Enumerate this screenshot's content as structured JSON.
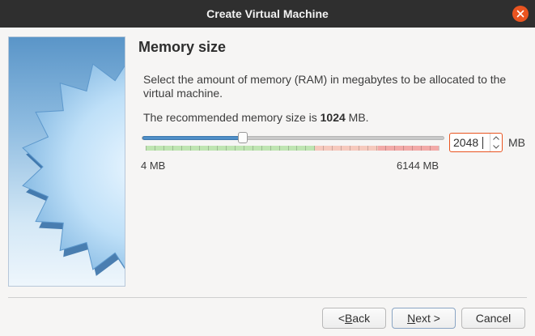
{
  "window": {
    "title": "Create Virtual Machine",
    "close_icon": "close-icon"
  },
  "page": {
    "title": "Memory size",
    "description": "Select the amount of memory (RAM) in megabytes to be allocated to the virtual machine.",
    "recommend_prefix": "The recommended memory size is ",
    "recommend_value": "1024",
    "recommend_suffix": " MB."
  },
  "memory": {
    "min_label": "4 MB",
    "max_label": "6144 MB",
    "value": "2048",
    "unit": "MB",
    "slider_fraction": 0.333
  },
  "buttons": {
    "back": {
      "pre": "< ",
      "mnemonic": "B",
      "post": "ack"
    },
    "next": {
      "pre": "",
      "mnemonic": "N",
      "post": "ext >"
    },
    "cancel": "Cancel"
  },
  "colors": {
    "accent": "#e95420",
    "slider_fill": "#4f8fc8",
    "zone_ok": "#bfe5b2",
    "zone_warn": "#f6c9bd",
    "zone_bad": "#f2aaa8"
  }
}
